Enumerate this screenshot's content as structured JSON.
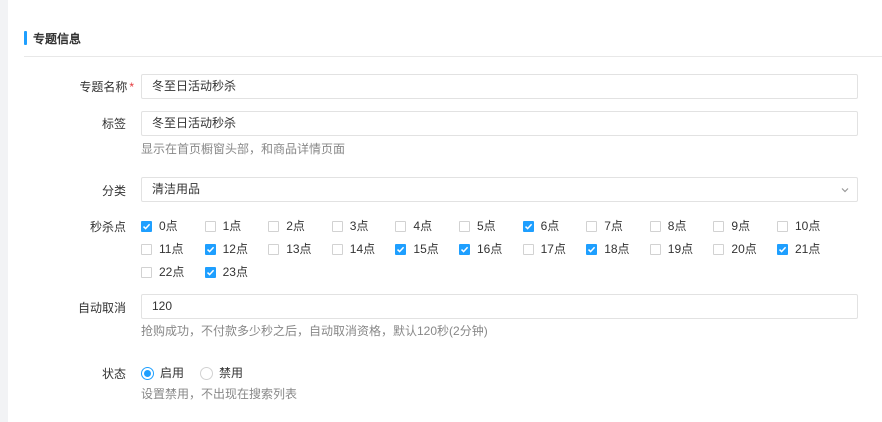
{
  "section": {
    "title": "专题信息"
  },
  "form": {
    "name": {
      "label": "专题名称",
      "required_mark": "*",
      "value": "冬至日活动秒杀"
    },
    "tag": {
      "label": "标签",
      "value": "冬至日活动秒杀",
      "hint": "显示在首页橱窗头部，和商品详情页面"
    },
    "category": {
      "label": "分类",
      "value": "清洁用品"
    },
    "seckill": {
      "label": "秒杀点",
      "hours": [
        {
          "label": "0点",
          "checked": true
        },
        {
          "label": "1点",
          "checked": false
        },
        {
          "label": "2点",
          "checked": false
        },
        {
          "label": "3点",
          "checked": false
        },
        {
          "label": "4点",
          "checked": false
        },
        {
          "label": "5点",
          "checked": false
        },
        {
          "label": "6点",
          "checked": true
        },
        {
          "label": "7点",
          "checked": false
        },
        {
          "label": "8点",
          "checked": false
        },
        {
          "label": "9点",
          "checked": false
        },
        {
          "label": "10点",
          "checked": false
        },
        {
          "label": "11点",
          "checked": false
        },
        {
          "label": "12点",
          "checked": true
        },
        {
          "label": "13点",
          "checked": false
        },
        {
          "label": "14点",
          "checked": false
        },
        {
          "label": "15点",
          "checked": true
        },
        {
          "label": "16点",
          "checked": true
        },
        {
          "label": "17点",
          "checked": false
        },
        {
          "label": "18点",
          "checked": true
        },
        {
          "label": "19点",
          "checked": false
        },
        {
          "label": "20点",
          "checked": false
        },
        {
          "label": "21点",
          "checked": true
        },
        {
          "label": "22点",
          "checked": false
        },
        {
          "label": "23点",
          "checked": true
        }
      ]
    },
    "auto_cancel": {
      "label": "自动取消",
      "value": "120",
      "hint": "抢购成功，不付款多少秒之后，自动取消资格，默认120秒(2分钟)"
    },
    "status": {
      "label": "状态",
      "options": [
        {
          "label": "启用",
          "checked": true
        },
        {
          "label": "禁用",
          "checked": false
        }
      ],
      "hint": "设置禁用，不出现在搜索列表"
    }
  },
  "colors": {
    "accent": "#1e9fff",
    "required": "#e4393c",
    "hint": "#888888"
  }
}
